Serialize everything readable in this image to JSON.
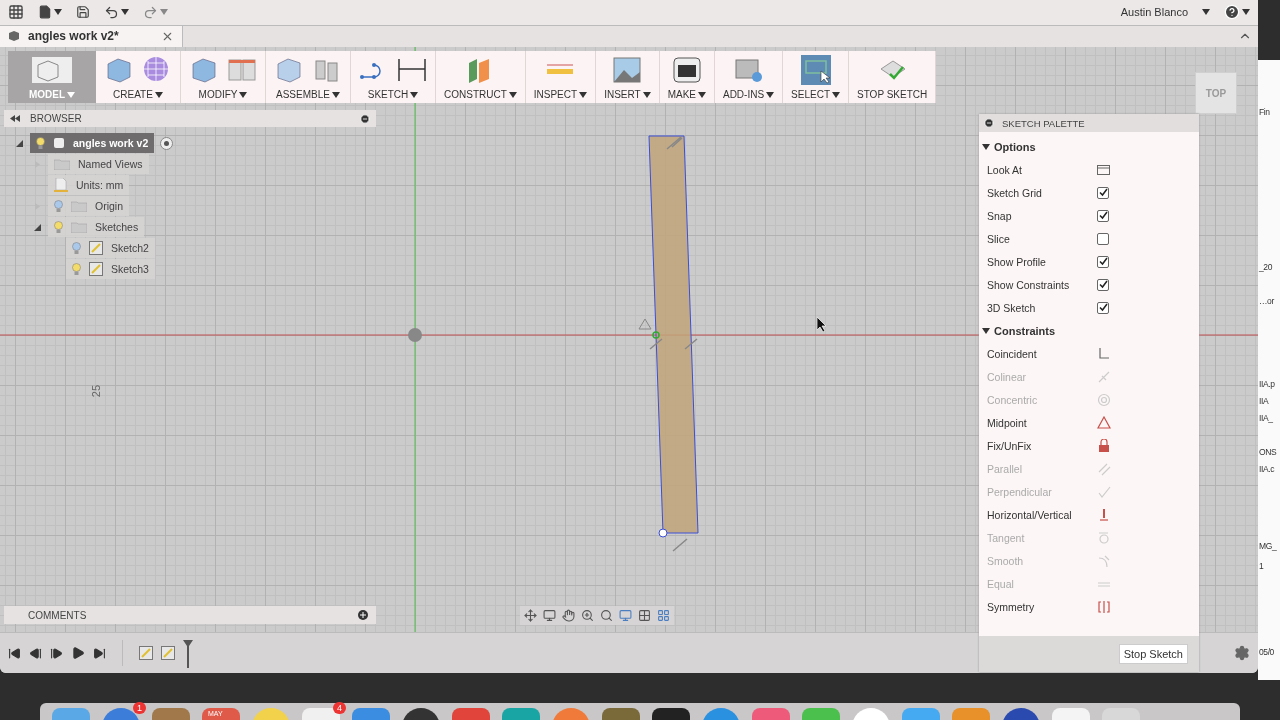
{
  "top_bar": {
    "user": "Austin Blanco"
  },
  "document_tab": {
    "title": "angles work v2*"
  },
  "toolbar": {
    "workspace": "MODEL",
    "groups": [
      {
        "label": "CREATE",
        "kind": "create",
        "dropdown": true,
        "selected": false
      },
      {
        "label": "MODIFY",
        "kind": "modify",
        "dropdown": true,
        "selected": false
      },
      {
        "label": "ASSEMBLE",
        "kind": "assemble",
        "dropdown": true,
        "selected": false
      },
      {
        "label": "SKETCH",
        "kind": "sketch",
        "dropdown": true,
        "selected": false
      },
      {
        "label": "CONSTRUCT",
        "kind": "construct",
        "dropdown": true,
        "selected": false
      },
      {
        "label": "INSPECT",
        "kind": "inspect",
        "dropdown": true,
        "selected": false
      },
      {
        "label": "INSERT",
        "kind": "insert",
        "dropdown": true,
        "selected": false
      },
      {
        "label": "MAKE",
        "kind": "make",
        "dropdown": true,
        "selected": false
      },
      {
        "label": "ADD-INS",
        "kind": "addins",
        "dropdown": true,
        "selected": false
      },
      {
        "label": "SELECT",
        "kind": "select",
        "dropdown": true,
        "selected": true
      },
      {
        "label": "STOP SKETCH",
        "kind": "stop",
        "dropdown": false,
        "selected": false
      }
    ]
  },
  "browser": {
    "title": "BROWSER",
    "tree": [
      {
        "label": "angles work v2",
        "kind": "component",
        "expanded": true,
        "visible": true,
        "selected": true,
        "children": [
          {
            "label": "Named Views",
            "kind": "folder",
            "expanded": false,
            "selected": false
          },
          {
            "label": "Units: mm",
            "kind": "units",
            "selected": false
          },
          {
            "label": "Origin",
            "kind": "folder",
            "expanded": false,
            "visible": false,
            "selected": false
          },
          {
            "label": "Sketches",
            "kind": "folder",
            "expanded": true,
            "visible": true,
            "selected": false,
            "children": [
              {
                "label": "Sketch2",
                "kind": "sketch",
                "visible": false,
                "selected": false
              },
              {
                "label": "Sketch3",
                "kind": "sketch",
                "visible": true,
                "selected": false
              }
            ]
          }
        ]
      }
    ]
  },
  "comments": {
    "title": "COMMENTS"
  },
  "canvas": {
    "ruler_label": "25"
  },
  "view_cube": {
    "label": "TOP"
  },
  "sketch_palette": {
    "title": "SKETCH PALETTE",
    "sections": [
      {
        "title": "Options",
        "expanded": true,
        "items": [
          {
            "label": "Look At",
            "kind": "action"
          },
          {
            "label": "Sketch Grid",
            "kind": "checkbox",
            "checked": true
          },
          {
            "label": "Snap",
            "kind": "checkbox",
            "checked": true
          },
          {
            "label": "Slice",
            "kind": "checkbox",
            "checked": false
          },
          {
            "label": "Show Profile",
            "kind": "checkbox",
            "checked": true
          },
          {
            "label": "Show Constraints",
            "kind": "checkbox",
            "checked": true
          },
          {
            "label": "3D Sketch",
            "kind": "checkbox",
            "checked": true
          }
        ]
      },
      {
        "title": "Constraints",
        "expanded": true,
        "items": [
          {
            "label": "Coincident",
            "kind": "coincident",
            "disabled": false
          },
          {
            "label": "Colinear",
            "kind": "colinear",
            "disabled": true
          },
          {
            "label": "Concentric",
            "kind": "concentric",
            "disabled": true
          },
          {
            "label": "Midpoint",
            "kind": "midpoint",
            "disabled": false
          },
          {
            "label": "Fix/UnFix",
            "kind": "fix",
            "disabled": false
          },
          {
            "label": "Parallel",
            "kind": "parallel",
            "disabled": true
          },
          {
            "label": "Perpendicular",
            "kind": "perpendicular",
            "disabled": true
          },
          {
            "label": "Horizontal/Vertical",
            "kind": "horizontal",
            "disabled": false
          },
          {
            "label": "Tangent",
            "kind": "tangent",
            "disabled": true
          },
          {
            "label": "Smooth",
            "kind": "smooth",
            "disabled": true
          },
          {
            "label": "Equal",
            "kind": "equal",
            "disabled": true
          },
          {
            "label": "Symmetry",
            "kind": "symmetry",
            "disabled": false
          }
        ]
      }
    ],
    "button": "Stop Sketch"
  },
  "timeline": {
    "features": [
      {
        "kind": "sketch"
      },
      {
        "kind": "sketch"
      }
    ]
  },
  "background_window": {
    "lines": [
      "Fin",
      "_20",
      "…or",
      "IIA.p",
      "IIA",
      "IIA_",
      "ONS",
      "IIA.c",
      "MG_",
      "1",
      "05/0"
    ]
  },
  "dock": {
    "items": [
      {
        "color": "#5aa9e6"
      },
      {
        "color": "#3b7dd8",
        "badge": "1"
      },
      {
        "color": "#a0784a"
      },
      {
        "color": "#e05a4a",
        "label": "MAY"
      },
      {
        "color": "#f2d24a"
      },
      {
        "color": "#f0f0f0",
        "badge": "4"
      },
      {
        "color": "#3a8de0"
      },
      {
        "color": "#333333"
      },
      {
        "color": "#e0443a"
      },
      {
        "color": "#1aa5a5"
      },
      {
        "color": "#f07a3a"
      },
      {
        "color": "#7a6a3a"
      },
      {
        "color": "#222222"
      },
      {
        "color": "#2a90e0"
      },
      {
        "color": "#ee5a7a"
      },
      {
        "color": "#4cc04c"
      },
      {
        "color": "#ffffff"
      },
      {
        "color": "#45aaf2"
      },
      {
        "color": "#e8902a"
      },
      {
        "color": "#2a4ab0"
      },
      {
        "color": "#f4f4f4"
      },
      {
        "color": "#d8d8d8"
      }
    ]
  }
}
